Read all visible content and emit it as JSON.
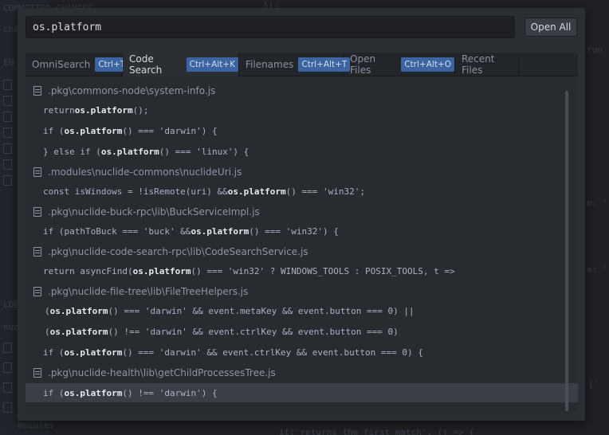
{
  "search": {
    "value": "os.platform"
  },
  "toolbar": {
    "open_all_label": "Open All"
  },
  "tabs": [
    {
      "label": "OmniSearch",
      "shortcut": "Ctrl+T"
    },
    {
      "label": "Code Search",
      "shortcut": "Ctrl+Alt+K",
      "active": true
    },
    {
      "label": "Filenames",
      "shortcut": "Ctrl+Alt+T"
    },
    {
      "label": "Open Files",
      "shortcut": "Ctrl+Alt+O"
    },
    {
      "label": "Recent Files"
    }
  ],
  "results": [
    {
      "type": "file",
      "path": ".pkg\\commons-node\\system-info.js"
    },
    {
      "type": "match",
      "pre": "return ",
      "hl": "os.platform",
      "post": "();"
    },
    {
      "type": "match",
      "pre": "if (",
      "hl": "os.platform",
      "post": "() === 'darwin') {"
    },
    {
      "type": "match",
      "pre": "} else if (",
      "hl": "os.platform",
      "post": "() === 'linux') {"
    },
    {
      "type": "file",
      "path": ".modules\\nuclide-commons\\nuclideUri.js"
    },
    {
      "type": "match",
      "pre": "const isWindows = !isRemote(uri) && ",
      "hl": "os.platform",
      "post": "() === 'win32';"
    },
    {
      "type": "file",
      "path": ".pkg\\nuclide-buck-rpc\\lib\\BuckServiceImpl.js"
    },
    {
      "type": "match",
      "pre": "if (pathToBuck === 'buck' && ",
      "hl": "os.platform",
      "post": "() === 'win32') {"
    },
    {
      "type": "file",
      "path": ".pkg\\nuclide-code-search-rpc\\lib\\CodeSearchService.js"
    },
    {
      "type": "match",
      "pre": "return asyncFind(",
      "hl": "os.platform",
      "post": "() === 'win32' ? WINDOWS_TOOLS : POSIX_TOOLS, t =>"
    },
    {
      "type": "file",
      "path": ".pkg\\nuclide-file-tree\\lib\\FileTreeHelpers.js"
    },
    {
      "type": "match",
      "pre": "(",
      "hl": "os.platform",
      "post": "() === 'darwin' && event.metaKey && event.button === 0) ||"
    },
    {
      "type": "match",
      "pre": "(",
      "hl": "os.platform",
      "post": "() !== 'darwin' && event.ctrlKey && event.button === 0)"
    },
    {
      "type": "match",
      "pre": "if (",
      "hl": "os.platform",
      "post": "() === 'darwin' && event.ctrlKey && event.button === 0) {"
    },
    {
      "type": "file",
      "path": ".pkg\\nuclide-health\\lib\\getChildProcessesTree.js"
    },
    {
      "type": "match",
      "pre": "if (",
      "hl": "os.platform",
      "post": "() !== 'darwin') {",
      "selected": true
    }
  ],
  "background": {
    "lines": [
      {
        "text": "COMMITTED CHANGES"
      },
      {
        "text": "char"
      },
      {
        "text": "EN F"
      },
      {
        "text": "LDER"
      },
      {
        "text": "nucl"
      },
      {
        "text": "mocules"
      },
      {
        "text": "});"
      },
      {
        "text": "run"
      },
      {
        "text": "e: '"
      },
      {
        "text": "e: '"
      },
      {
        "text": "['"
      },
      {
        "text": "it('returns the first match', () => {"
      }
    ]
  }
}
